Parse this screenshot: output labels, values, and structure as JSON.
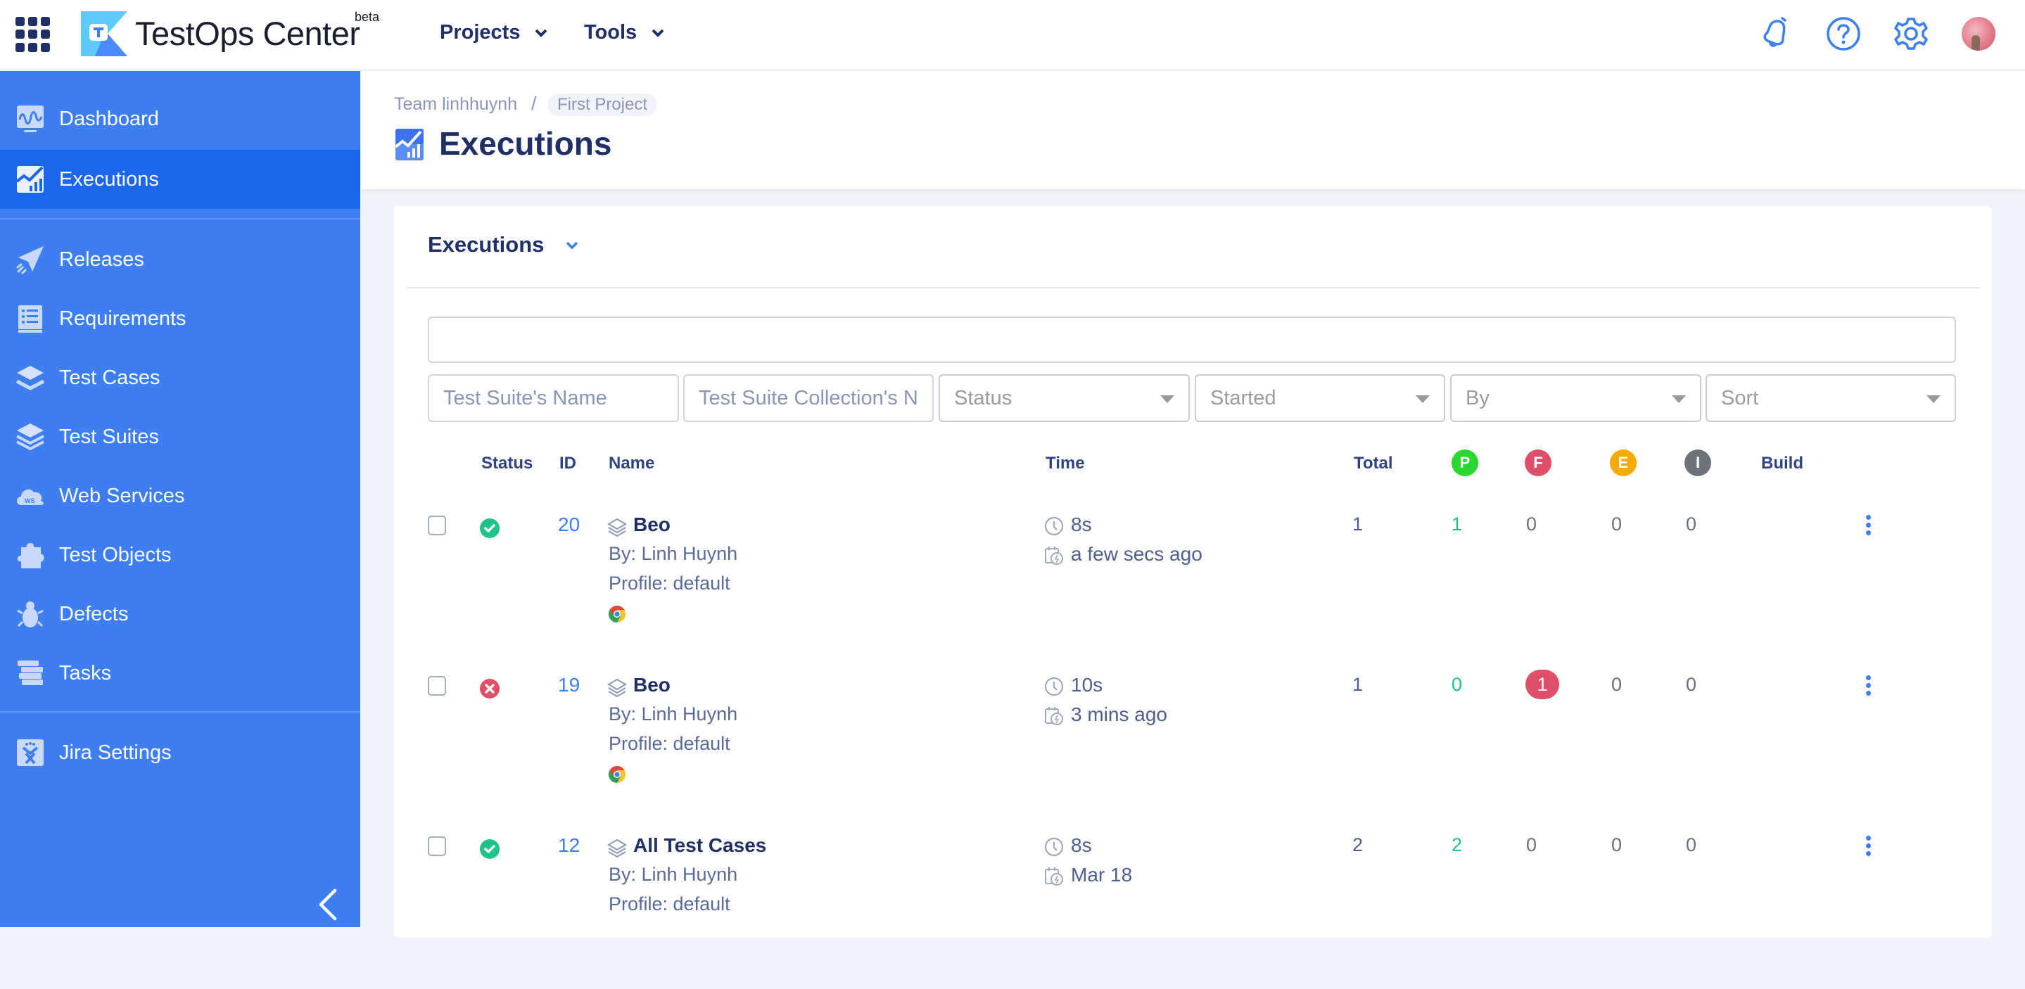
{
  "topbar": {
    "brand": "TestOps Center",
    "badge": "beta",
    "menus": [
      {
        "label": "Projects"
      },
      {
        "label": "Tools"
      }
    ],
    "icons": [
      "apps-grid-icon",
      "bell-icon",
      "help-icon",
      "gear-icon",
      "avatar"
    ]
  },
  "sidebar": {
    "items": [
      {
        "label": "Dashboard",
        "icon": "dashboard-icon"
      },
      {
        "label": "Executions",
        "icon": "executions-icon",
        "active": true
      },
      {
        "label": "Releases",
        "icon": "paper-plane-icon"
      },
      {
        "label": "Requirements",
        "icon": "list-icon"
      },
      {
        "label": "Test Cases",
        "icon": "layers-icon"
      },
      {
        "label": "Test Suites",
        "icon": "stack-icon"
      },
      {
        "label": "Web Services",
        "icon": "cloud-ws-icon"
      },
      {
        "label": "Test Objects",
        "icon": "puzzle-icon"
      },
      {
        "label": "Defects",
        "icon": "bug-icon"
      },
      {
        "label": "Tasks",
        "icon": "books-icon"
      },
      {
        "label": "Jira Settings",
        "icon": "jira-icon"
      }
    ],
    "collapse_icon": "chevron-left-icon"
  },
  "breadcrumb": {
    "team": "Team linhhuynh",
    "separator": "/",
    "project": "First Project"
  },
  "page": {
    "title": "Executions"
  },
  "card": {
    "title": "Executions",
    "search_value": "",
    "filters": {
      "suite_name_placeholder": "Test Suite's Name",
      "collection_name_placeholder": "Test Suite Collection's N",
      "status": "Status",
      "started": "Started",
      "by": "By",
      "sort": "Sort"
    }
  },
  "table": {
    "headers": {
      "status": "Status",
      "id": "ID",
      "name": "Name",
      "time": "Time",
      "total": "Total",
      "passed": "P",
      "failed": "F",
      "error": "E",
      "incomplete": "I",
      "build": "Build"
    },
    "colors": {
      "passed": "#29d72e",
      "failed": "#df5068",
      "error": "#f7ab00",
      "incomplete": "#6c737b",
      "accent": "#3d7ff3"
    },
    "rows": [
      {
        "status": "passed",
        "id": "20",
        "name": "Beo",
        "by": "By: Linh Huynh",
        "profile": "Profile: default",
        "browser": "chrome",
        "duration": "8s",
        "started": "a few secs ago",
        "total": "1",
        "passed": "1",
        "failed": "0",
        "error": "0",
        "incomplete": "0",
        "build": ""
      },
      {
        "status": "failed",
        "id": "19",
        "name": "Beo",
        "by": "By: Linh Huynh",
        "profile": "Profile: default",
        "browser": "chrome",
        "duration": "10s",
        "started": "3 mins ago",
        "total": "1",
        "passed": "0",
        "failed": "1",
        "error": "0",
        "incomplete": "0",
        "build": ""
      },
      {
        "status": "passed",
        "id": "12",
        "name": "All Test Cases",
        "by": "By: Linh Huynh",
        "profile": "Profile: default",
        "browser": "",
        "duration": "8s",
        "started": "Mar 18",
        "total": "2",
        "passed": "2",
        "failed": "0",
        "error": "0",
        "incomplete": "0",
        "build": ""
      }
    ]
  }
}
